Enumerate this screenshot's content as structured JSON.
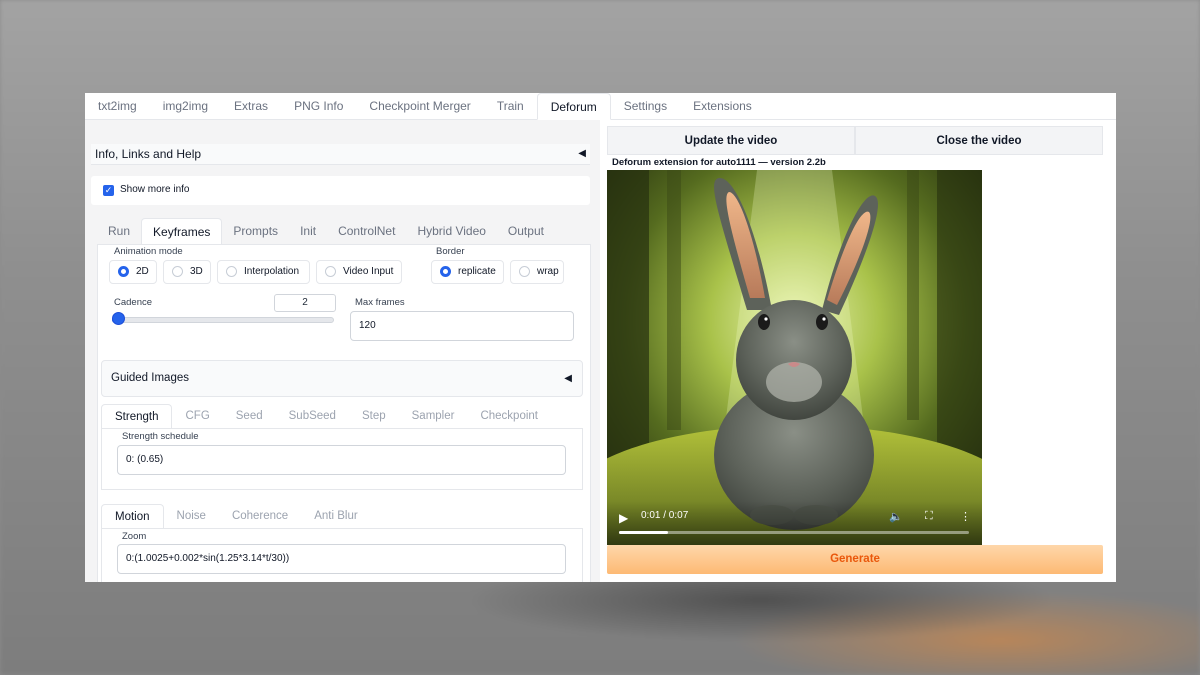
{
  "top_tabs": [
    "txt2img",
    "img2img",
    "Extras",
    "PNG Info",
    "Checkpoint Merger",
    "Train",
    "Deforum",
    "Settings",
    "Extensions"
  ],
  "top_tab_active": "Deforum",
  "accordion": {
    "title": "Info, Links and Help"
  },
  "show_more_info": {
    "label": "Show more info",
    "checked": true
  },
  "sub_tabs": [
    "Run",
    "Keyframes",
    "Prompts",
    "Init",
    "ControlNet",
    "Hybrid Video",
    "Output"
  ],
  "sub_tab_active": "Keyframes",
  "animation_mode": {
    "label": "Animation mode",
    "options": [
      "2D",
      "3D",
      "Interpolation",
      "Video Input"
    ],
    "selected": "2D"
  },
  "border": {
    "label": "Border",
    "options": [
      "replicate",
      "wrap"
    ],
    "selected": "replicate"
  },
  "cadence": {
    "label": "Cadence",
    "value": "2",
    "slider_fraction": 0.0
  },
  "max_frames": {
    "label": "Max frames",
    "value": "120"
  },
  "guided_images": {
    "title": "Guided Images"
  },
  "schedule_tabs": [
    "Strength",
    "CFG",
    "Seed",
    "SubSeed",
    "Step",
    "Sampler",
    "Checkpoint"
  ],
  "schedule_tab_active": "Strength",
  "strength_schedule": {
    "label": "Strength schedule",
    "value": "0: (0.65)"
  },
  "motion_tabs": [
    "Motion",
    "Noise",
    "Coherence",
    "Anti Blur"
  ],
  "motion_tab_active": "Motion",
  "zoom": {
    "label": "Zoom",
    "value": "0:(1.0025+0.002*sin(1.25*3.14*t/30))"
  },
  "video_buttons": {
    "update": "Update the video",
    "close": "Close the video"
  },
  "extension_info": "Deforum extension for auto1111 — version 2.2b",
  "video": {
    "time": "0:01 / 0:07",
    "progress_fraction": 0.14
  },
  "generate_label": "Generate",
  "colors": {
    "accent": "#2563eb",
    "generate_text": "#ea580c",
    "generate_bg": "#fdba74"
  }
}
